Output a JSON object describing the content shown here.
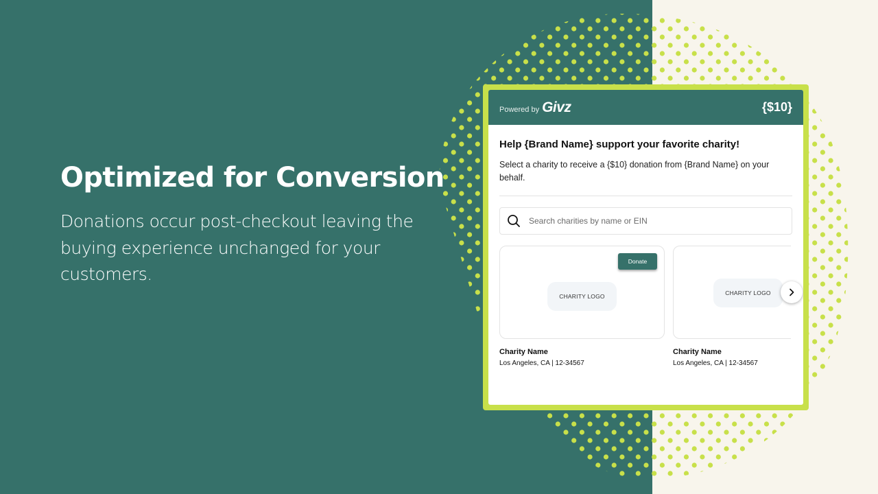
{
  "colors": {
    "teal": "#36716a",
    "cream": "#f8f5ec",
    "lime": "#c8e04a",
    "white": "#ffffff"
  },
  "hero": {
    "title": "Optimized for Conversion",
    "body": "Donations occur post-checkout leaving the buying experience unchanged for your customers."
  },
  "widget": {
    "header": {
      "powered_by": "Powered by",
      "brand": "Givz",
      "amount": "{$10}"
    },
    "title": "Help {Brand Name} support your favorite charity!",
    "description": "Select a charity to receive a {$10} donation from {Brand Name} on your behalf.",
    "search": {
      "icon": "search-icon",
      "placeholder": "Search charities by name or EIN",
      "value": ""
    },
    "charities": [
      {
        "logo_label": "CHARITY LOGO",
        "name": "Charity Name",
        "meta": "Los Angeles, CA | 12-34567",
        "donate_label": "Donate"
      },
      {
        "logo_label": "CHARITY LOGO",
        "name": "Charity Name",
        "meta": "Los Angeles, CA | 12-34567"
      }
    ],
    "next_icon": "chevron-right-icon"
  }
}
